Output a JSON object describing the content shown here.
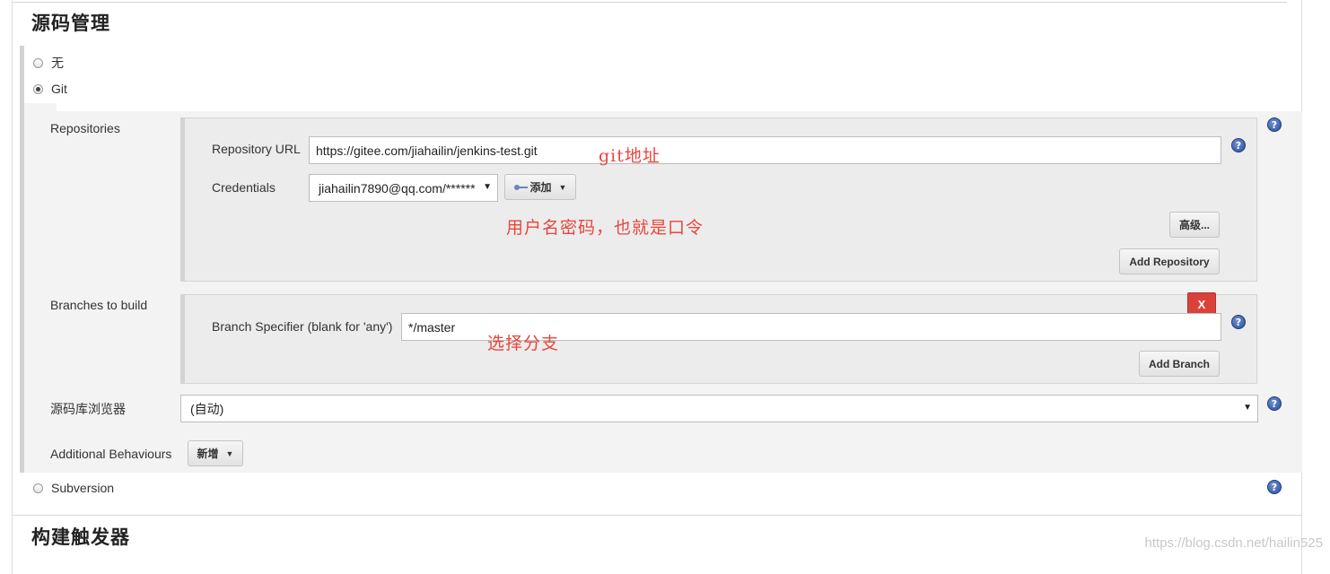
{
  "section": {
    "title": "源码管理"
  },
  "next_section": {
    "title": "构建触发器"
  },
  "scm_options": [
    {
      "label": "无",
      "selected": false
    },
    {
      "label": "Git",
      "selected": true
    },
    {
      "label": "Subversion",
      "selected": false
    }
  ],
  "git": {
    "repositories_label": "Repositories",
    "repository_url_label": "Repository URL",
    "repository_url_value": "https://gitee.com/jiahailin/jenkins-test.git",
    "credentials_label": "Credentials",
    "credentials_value": "jiahailin7890@qq.com/******",
    "add_button_label": "添加",
    "advanced_button_label": "高级...",
    "add_repository_label": "Add Repository",
    "branches_label": "Branches to build",
    "delete_branch_label": "X",
    "branch_specifier_label": "Branch Specifier (blank for 'any')",
    "branch_specifier_value": "*/master",
    "add_branch_label": "Add Branch",
    "browser_label": "源码库浏览器",
    "browser_value": "(自动)",
    "additional_behaviours_label": "Additional Behaviours",
    "add_behaviour_label": "新增"
  },
  "annotations": {
    "git_address": "git地址",
    "credentials_note": "用户名密码，也就是口令",
    "branch_note": "选择分支"
  },
  "help_glyph": "?",
  "watermark": "https://blog.csdn.net/hailin525",
  "colors": {
    "danger": "#d9423a",
    "annotation": "#e8453c",
    "help": "#2b4f9b"
  }
}
